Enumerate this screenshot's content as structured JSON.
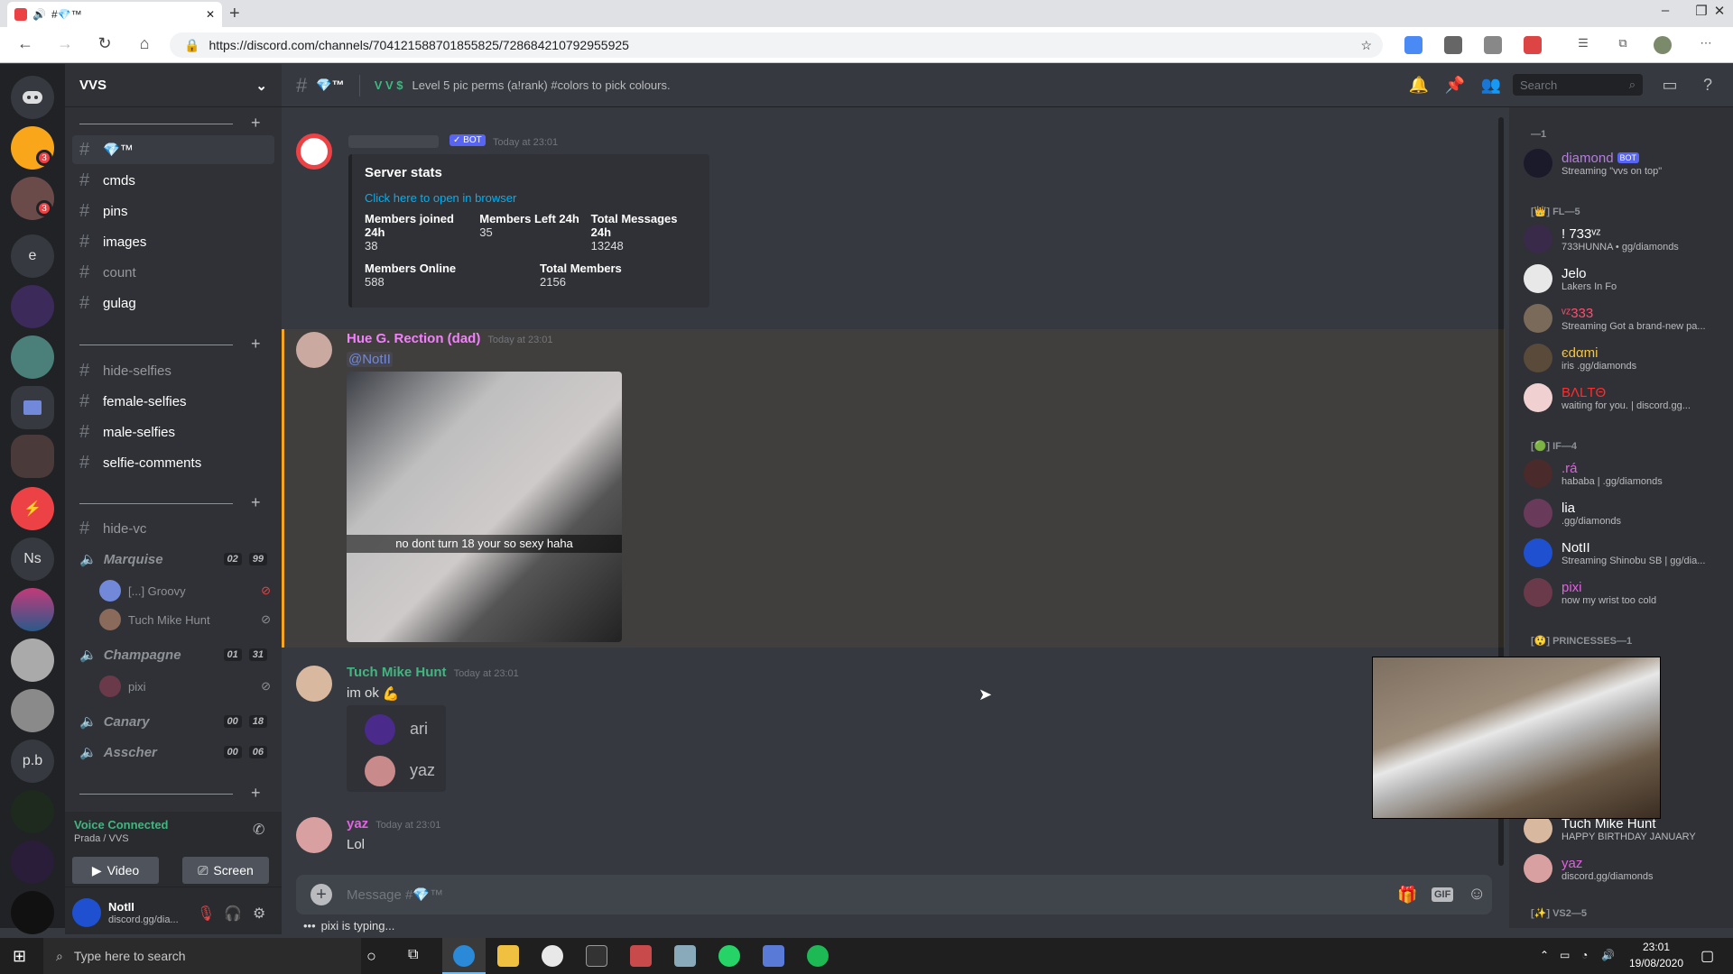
{
  "browser": {
    "tab_title": "#💎™",
    "url": "https://discord.com/channels/704121588701855825/728684210792955925",
    "window_controls": [
      "–",
      "❐",
      "✕"
    ]
  },
  "server": {
    "name": "VVS"
  },
  "servers": [
    "e",
    "Ns",
    "p.b"
  ],
  "channels": {
    "current": "💎™",
    "group1": [
      "cmds",
      "pins",
      "images",
      "count",
      "gulag"
    ],
    "group2": [
      "hide-selfies",
      "female-selfies",
      "male-selfies",
      "selfie-comments"
    ],
    "hide_vc": "hide-vc",
    "voice": [
      {
        "name": "Marquise",
        "count_a": "02",
        "count_b": "99",
        "users": [
          "[...] Groovy",
          "Tuch Mike Hunt"
        ]
      },
      {
        "name": "Champagne",
        "count_a": "01",
        "count_b": "31",
        "users": [
          "pixi"
        ]
      },
      {
        "name": "Canary",
        "count_a": "00",
        "count_b": "18",
        "users": []
      },
      {
        "name": "Asscher",
        "count_a": "00",
        "count_b": "06",
        "users": []
      }
    ]
  },
  "voice_panel": {
    "status": "Voice Connected",
    "location": "Prada / VVS",
    "video": "Video",
    "screen": "Screen"
  },
  "user_panel": {
    "name": "NotII",
    "tag": "discord.gg/dia..."
  },
  "header": {
    "channel": "💎™",
    "topic": "Level 5 pic perms (a!rank) #colors to pick colours.",
    "search_placeholder": "Search"
  },
  "messages": {
    "bot_badge": "✓ BOT",
    "bot_time": "Today at 23:01",
    "embed": {
      "title": "Server stats",
      "link": "Click here to open in browser",
      "fields": [
        {
          "name": "Members joined 24h",
          "value": "38"
        },
        {
          "name": "Members Left 24h",
          "value": "35"
        },
        {
          "name": "Total Messages 24h",
          "value": "13248"
        },
        {
          "name": "Members Online",
          "value": "588"
        },
        {
          "name": "Total Members",
          "value": "2156"
        }
      ]
    },
    "m1": {
      "author": "Hue G. Rection (dad)",
      "time": "Today at 23:01",
      "mention": "@NotII",
      "caption": "no dont turn 18 your so sexy haha"
    },
    "m2": {
      "author": "Tuch Mike Hunt",
      "time": "Today at 23:01",
      "text": "im ok",
      "emoji": "💪",
      "react1": "ari",
      "react2": "yaz"
    },
    "m3": {
      "author": "yaz",
      "time": "Today at 23:01",
      "text": "Lol"
    }
  },
  "input": {
    "placeholder": "Message #💎™",
    "typing": "pixi is typing..."
  },
  "members": {
    "groups": [
      {
        "label": "—1"
      },
      {
        "label": "[👑] FL—5"
      },
      {
        "label": "[🟢] IF—4"
      },
      {
        "label": "[😲] PRINCESSES—1"
      },
      {
        "label": "[✨] VS2—5"
      }
    ],
    "list": [
      {
        "name": "diamond",
        "badge": "BOT",
        "status": "Streaming \"vvs on top\"",
        "color": "#b57edc"
      },
      {
        "name": "! 733ᵛᶻ",
        "status": "733HUNNA • gg/diamonds",
        "color": "#ffffff"
      },
      {
        "name": "Jelo",
        "status": "Lakers In Fo",
        "color": "#ffffff"
      },
      {
        "name": "ᵛᶻ333",
        "status": "Streaming Got a brand-new pa...",
        "color": "#ff4d6d"
      },
      {
        "name": "єdαmi",
        "status": "iris .gg/diamonds",
        "color": "#f5c542"
      },
      {
        "name": "ВΛLТΘ",
        "status": "waiting for you. | discord.gg...",
        "color": "#ff2d2d"
      },
      {
        "name": ".rá",
        "status": "hababa | .gg/diamonds",
        "color": "#e062e0"
      },
      {
        "name": "lia",
        "status": ".gg/diamonds",
        "color": "#ffffff"
      },
      {
        "name": "NotII",
        "status": "Streaming Shinobu SB | gg/dia...",
        "color": "#ffffff"
      },
      {
        "name": "pixi",
        "status": "now my wrist too cold",
        "color": "#e062e0"
      },
      {
        "name": "Tuch Mike Hunt",
        "status": "HAPPY BIRTHDAY JANUARY",
        "color": "#ffffff"
      },
      {
        "name": "yaz",
        "status": "discord.gg/diamonds",
        "color": "#e062e0"
      }
    ]
  },
  "taskbar": {
    "search": "Type here to search",
    "time": "23:01",
    "date": "19/08/2020"
  },
  "colors": {
    "accent": "#faa61a",
    "link": "#00b0f4",
    "mention": "#7289da",
    "hue": "#f47fff",
    "tuch": "#43b581",
    "yaz": "#e062e0"
  }
}
